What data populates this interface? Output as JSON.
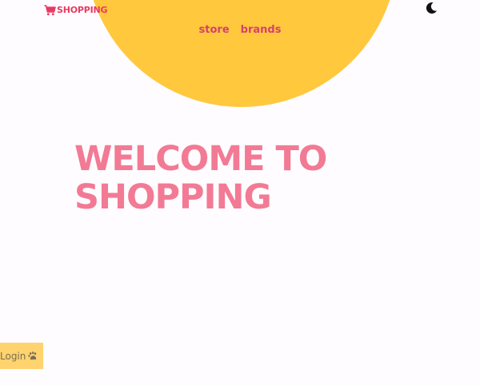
{
  "brand": {
    "logo_text": "SHOPPING",
    "logo_icon": "shopping-cart-icon",
    "color": "#e83a62"
  },
  "nav": {
    "items": [
      {
        "label": "store"
      },
      {
        "label": "brands"
      }
    ]
  },
  "theme_toggle": {
    "icon": "moon-icon"
  },
  "hero": {
    "title_line1": "WELCOME TO",
    "title_line2": "SHOPPING",
    "title_color": "#f27a95",
    "sun_color": "#ffc83d"
  },
  "login": {
    "label": "Login",
    "icon": "paw-icon",
    "background": "#ffd36e"
  }
}
